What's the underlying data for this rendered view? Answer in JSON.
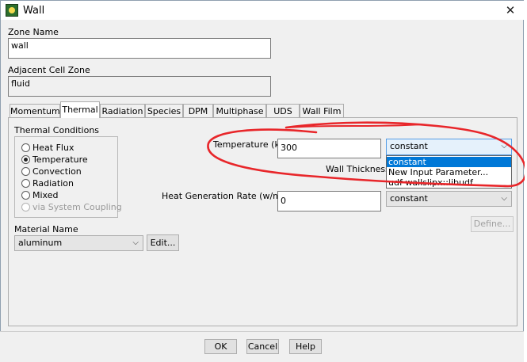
{
  "window": {
    "title": "Wall"
  },
  "zone": {
    "label": "Zone Name",
    "value": "wall"
  },
  "adjacent": {
    "label": "Adjacent Cell Zone",
    "value": "fluid"
  },
  "tabs": [
    "Momentum",
    "Thermal",
    "Radiation",
    "Species",
    "DPM",
    "Multiphase",
    "UDS",
    "Wall Film"
  ],
  "thermal": {
    "conditions_label": "Thermal Conditions",
    "options": [
      "Heat Flux",
      "Temperature",
      "Convection",
      "Radiation",
      "Mixed",
      "via System Coupling"
    ],
    "selected": "Temperature",
    "temperature_label": "Temperature (k)",
    "temperature_value": "300",
    "temperature_method": "constant",
    "dropdown_options": [
      "constant",
      "New Input Parameter...",
      "udf wallslipx::libudf"
    ],
    "wall_thickness_label": "Wall Thickness (",
    "heat_gen_label": "Heat Generation Rate (w/m3)",
    "heat_gen_value": "0",
    "heat_gen_method": "constant",
    "define_label": "Define...",
    "material_label": "Material Name",
    "material_value": "aluminum",
    "edit_label": "Edit..."
  },
  "footer": {
    "ok": "OK",
    "cancel": "Cancel",
    "help": "Help"
  },
  "annotation_color": "#e8262a"
}
